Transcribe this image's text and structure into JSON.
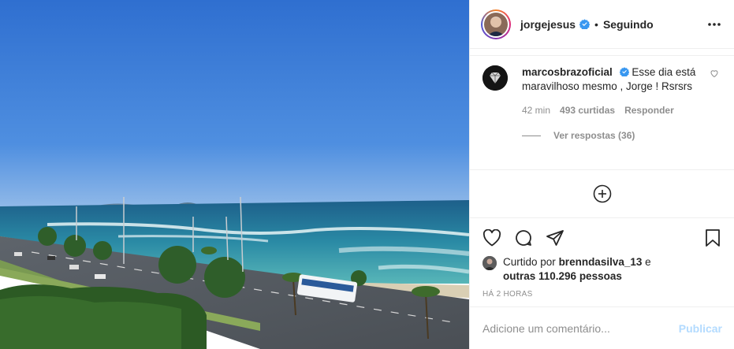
{
  "post": {
    "author": {
      "username": "jorgejesus",
      "verified": true,
      "follow_state": "Seguindo",
      "separator": "•"
    },
    "icons": {
      "more": "more-options-icon",
      "verified": "verified-badge-icon",
      "like": "heart-icon",
      "comment": "comment-icon",
      "share": "share-icon",
      "save": "bookmark-icon",
      "load_more": "plus-circle-icon",
      "comment_like": "small-heart-icon"
    },
    "comments": [
      {
        "username": "marcosbrazoficial",
        "verified": true,
        "text": "Esse dia está maravilhoso mesmo , Jorge ! Rsrsrs",
        "time": "42 min",
        "likes": "493 curtidas",
        "reply_label": "Responder",
        "view_replies": "Ver respostas (36)"
      }
    ],
    "likes": {
      "prefix": "Curtido por",
      "first_liker": "brenndasilva_13",
      "conjunction": "e",
      "others": "outras 110.296 pessoas"
    },
    "timestamp": "HÁ 2 HORAS",
    "add_comment": {
      "placeholder": "Adicione um comentário...",
      "submit_label": "Publicar"
    }
  },
  "colors": {
    "sky": "#3f7fd8",
    "ocean": "#2f8fa8",
    "verified_blue": "#3897f0",
    "publish_disabled": "#b3dbff",
    "muted_text": "#8e8e8e"
  }
}
